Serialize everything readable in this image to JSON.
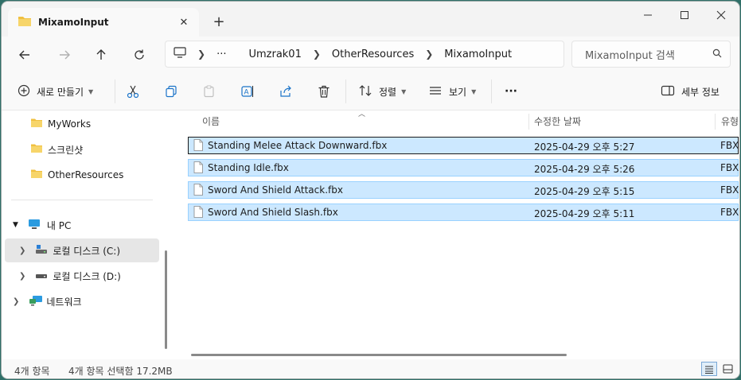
{
  "window": {
    "tab_title": "MixamoInput",
    "new_tab": "+",
    "close_tab": "✕"
  },
  "nav": {
    "breadcrumb": [
      "Umzrak01",
      "OtherResources",
      "MixamoInput"
    ],
    "overflow": "···",
    "search_placeholder": "MixamoInput 검색"
  },
  "toolbar": {
    "new_label": "새로 만들기",
    "sort_label": "정렬",
    "view_label": "보기",
    "more_label": "···",
    "details_label": "세부 정보"
  },
  "sidebar": {
    "items": [
      {
        "label": "MyWorks"
      },
      {
        "label": "스크린샷"
      },
      {
        "label": "OtherResources"
      },
      {
        "label": "내 PC"
      },
      {
        "label": "로컬 디스크 (C:)"
      },
      {
        "label": "로컬 디스크 (D:)"
      },
      {
        "label": "네트워크"
      }
    ]
  },
  "columns": {
    "name": "이름",
    "date": "수정한 날짜",
    "type": "유형"
  },
  "files": [
    {
      "name": "Standing Melee Attack Downward.fbx",
      "date": "2025-04-29 오후 5:27",
      "type": "FBX"
    },
    {
      "name": "Standing Idle.fbx",
      "date": "2025-04-29 오후 5:26",
      "type": "FBX"
    },
    {
      "name": "Sword And Shield Attack.fbx",
      "date": "2025-04-29 오후 5:15",
      "type": "FBX"
    },
    {
      "name": "Sword And Shield Slash.fbx",
      "date": "2025-04-29 오후 5:11",
      "type": "FBX"
    }
  ],
  "status": {
    "count": "4개 항목",
    "selection": "4개 항목 선택함 17.2MB"
  },
  "colors": {
    "selection_bg": "#cce8ff",
    "selection_border": "#99d1ff",
    "folder": "#f0c040"
  },
  "icons": [
    "folder-icon",
    "close-icon",
    "minimize-icon",
    "maximize-icon",
    "back-icon",
    "forward-icon",
    "up-icon",
    "refresh-icon",
    "monitor-icon",
    "search-icon",
    "plus-circle-icon",
    "cut-icon",
    "copy-icon",
    "paste-icon",
    "rename-icon",
    "share-icon",
    "trash-icon",
    "sort-icon",
    "view-icon",
    "details-pane-icon",
    "file-icon",
    "drive-icon",
    "network-icon",
    "details-view-icon",
    "tiles-view-icon"
  ]
}
